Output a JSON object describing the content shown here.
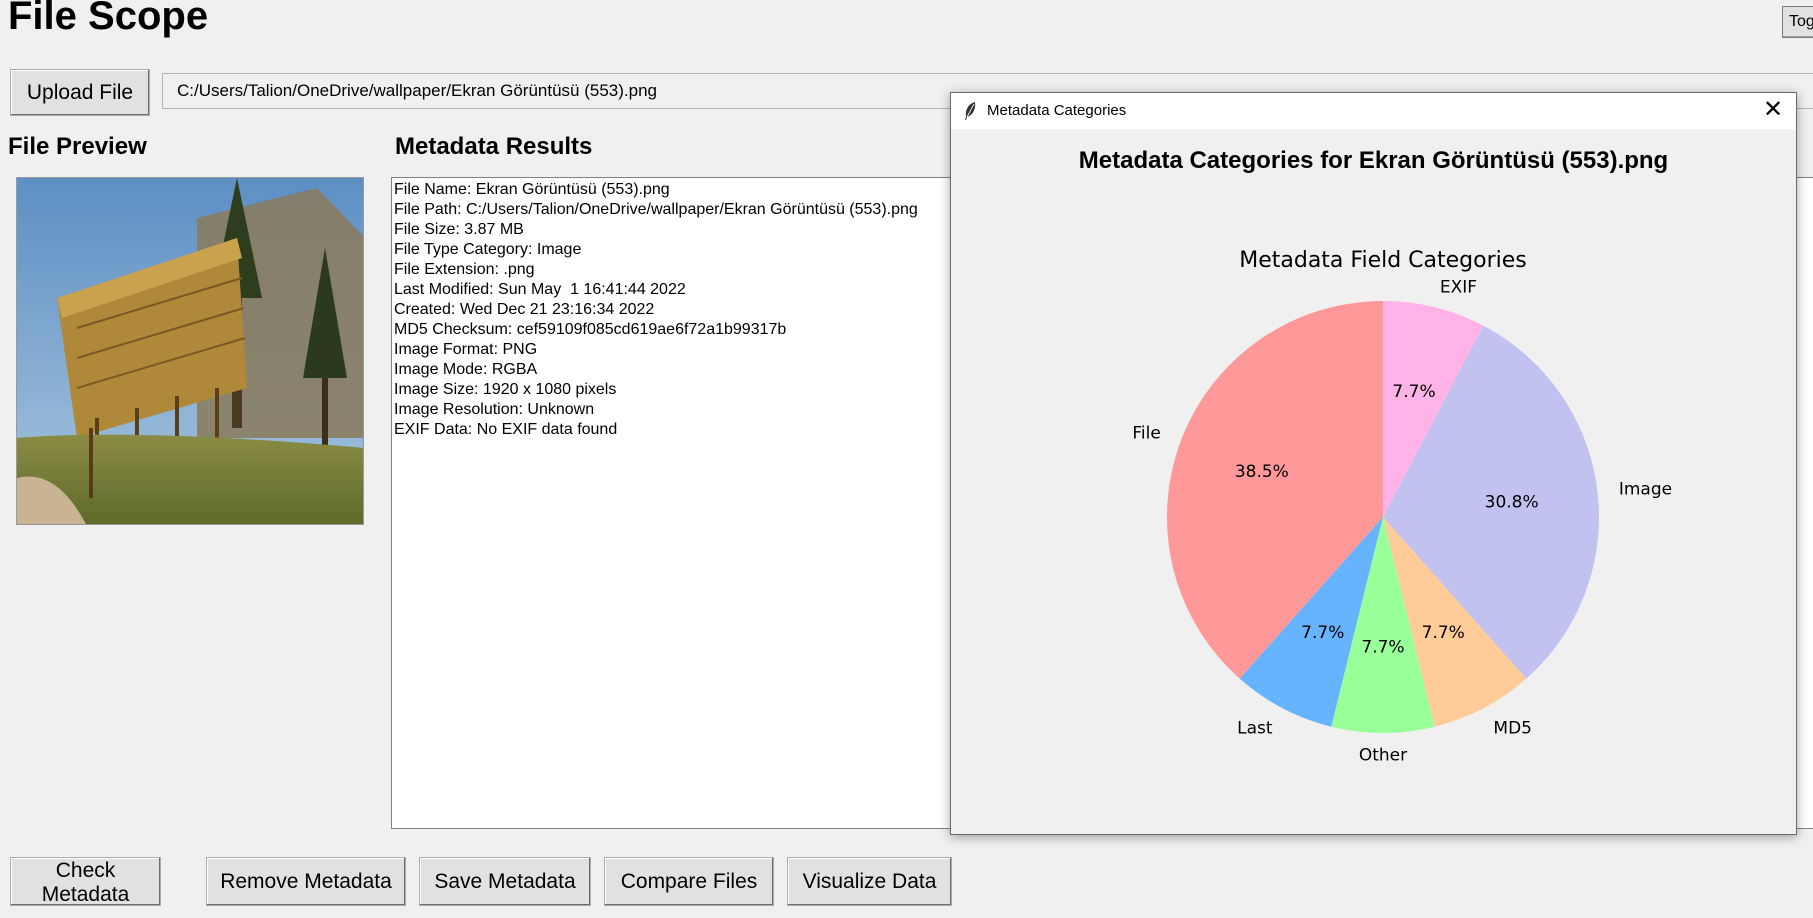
{
  "app": {
    "title": "File Scope",
    "toggle_label": "Toggle"
  },
  "upload": {
    "button_label": "Upload File",
    "path_value": "C:/Users/Talion/OneDrive/wallpaper/Ekran Görüntüsü (553).png"
  },
  "sections": {
    "preview_heading": "File Preview",
    "results_heading": "Metadata Results"
  },
  "metadata_lines": [
    "File Name: Ekran Görüntüsü (553).png",
    "File Path: C:/Users/Talion/OneDrive/wallpaper/Ekran Görüntüsü (553).png",
    "File Size: 3.87 MB",
    "File Type Category: Image",
    "File Extension: .png",
    "Last Modified: Sun May  1 16:41:44 2022",
    "Created: Wed Dec 21 23:16:34 2022",
    "MD5 Checksum: cef59109f085cd619ae6f72a1b99317b",
    "Image Format: PNG",
    "Image Mode: RGBA",
    "Image Size: 1920 x 1080 pixels",
    "Image Resolution: Unknown",
    "EXIF Data: No EXIF data found"
  ],
  "actions": {
    "check": "Check Metadata",
    "remove": "Remove Metadata",
    "save": "Save Metadata",
    "compare": "Compare Files",
    "visualize": "Visualize Data"
  },
  "popup": {
    "window_title": "Metadata Categories",
    "icon": "feather-icon",
    "close_icon": "close-icon",
    "heading": "Metadata Categories for Ekran Görüntüsü (553).png"
  },
  "chart_data": {
    "type": "pie",
    "title": "Metadata Field Categories",
    "categories": [
      "File",
      "Last",
      "Other",
      "MD5",
      "Image",
      "EXIF"
    ],
    "values": [
      5,
      1,
      1,
      1,
      4,
      1
    ],
    "percent_labels": [
      "38.5%",
      "7.7%",
      "7.7%",
      "7.7%",
      "30.8%",
      "7.7%"
    ],
    "colors": [
      "#ff9999",
      "#66b3ff",
      "#99ff99",
      "#ffcc99",
      "#c2c2f0",
      "#ffb3e6"
    ],
    "start_angle_deg": 90,
    "direction": "counterclockwise"
  }
}
